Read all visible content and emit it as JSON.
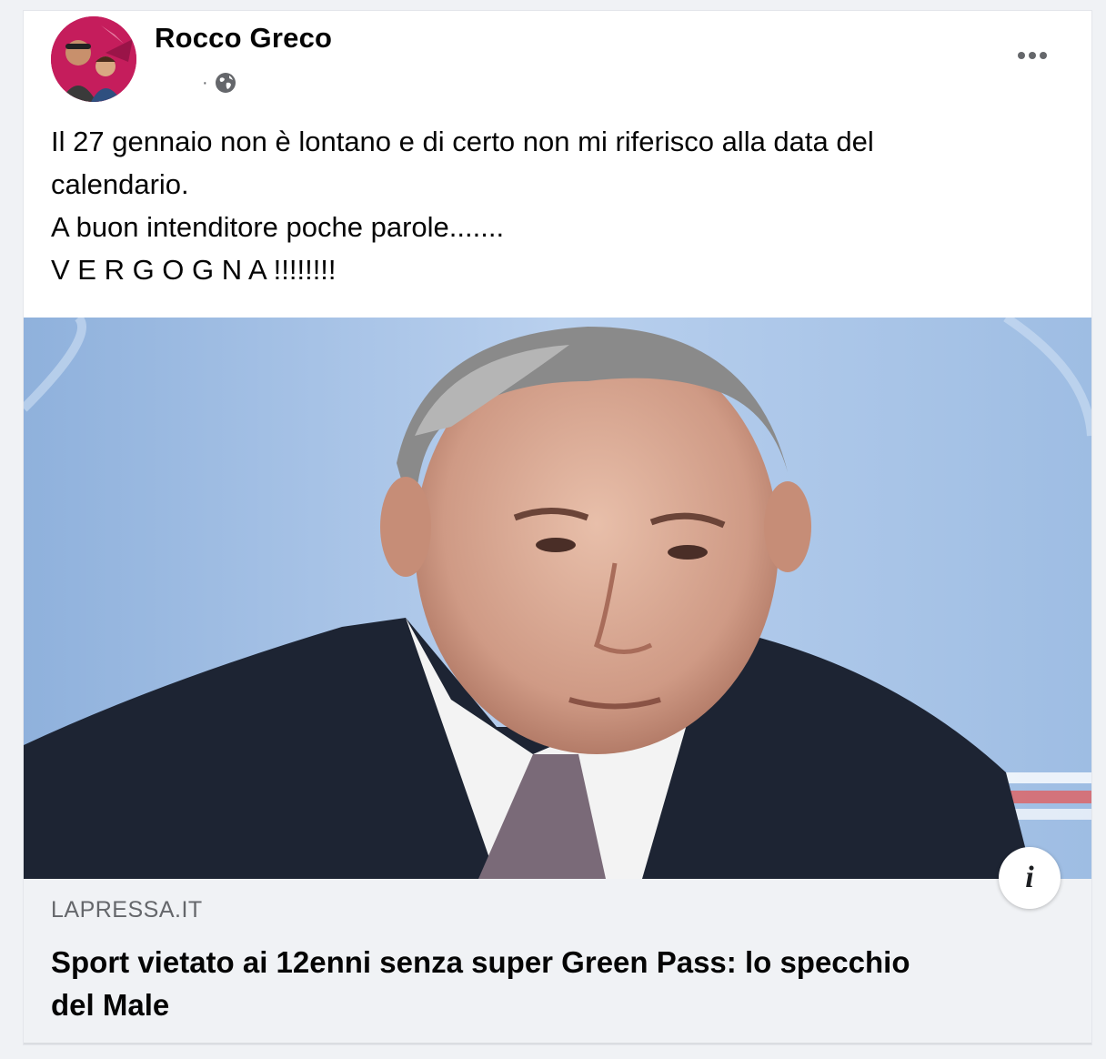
{
  "post": {
    "author": "Rocco Greco",
    "privacy_icon": "globe-icon",
    "more_icon": "more-options-icon",
    "text_lines": [
      "Il 27 gennaio non è lontano e di certo non mi riferisco alla data del",
      "calendario.",
      "A buon intenditore poche parole.......",
      "V E R G O G N A !!!!!!!!"
    ]
  },
  "link": {
    "domain": "LAPRESSA.IT",
    "title": "Sport vietato ai 12enni senza super Green Pass: lo specchio del Male",
    "info_label": "i"
  },
  "colors": {
    "background": "#f0f2f5",
    "card": "#ffffff",
    "secondary_text": "#65676b",
    "primary_text": "#050505"
  }
}
